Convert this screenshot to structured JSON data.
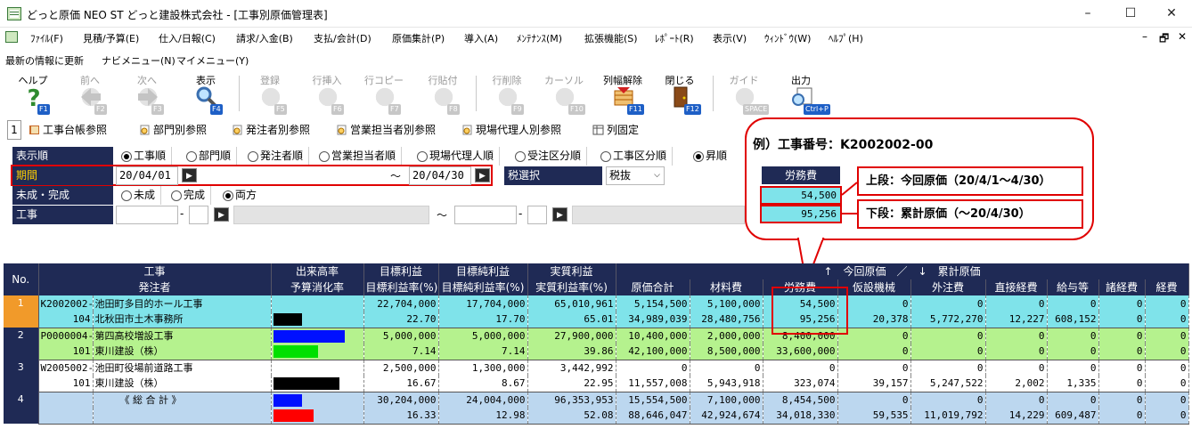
{
  "window": {
    "title": "どっと原価 NEO ST どっと建設株式会社 - [工事別原価管理表]",
    "controls": [
      "–",
      "☐",
      "✕"
    ],
    "mdi_controls": [
      "–",
      "🗗",
      "✕"
    ]
  },
  "menu": [
    "ﾌｧｲﾙ(F)",
    "見積/予算(E)",
    "仕入/日報(C)",
    "請求/入金(B)",
    "支払/会計(D)",
    "原価集計(P)",
    "導入(A)",
    "ﾒﾝﾃﾅﾝｽ(M)",
    "拡張機能(S)",
    "ﾚﾎﾟｰﾄ(R)",
    "表示(V)",
    "ｳｨﾝﾄﾞｳ(W)",
    "ﾍﾙﾌﾟ(H)"
  ],
  "infobar": [
    "最新の情報に更新",
    "ナビメニュー(N)",
    "マイメニュー(Y)"
  ],
  "toolbar": [
    {
      "label": "ヘルプ",
      "key": "F1",
      "icon": "help-icon",
      "enabled": true
    },
    {
      "label": "前へ",
      "key": "F2",
      "icon": "back-arrow-icon",
      "enabled": false
    },
    {
      "label": "次へ",
      "key": "F3",
      "icon": "forward-arrow-icon",
      "enabled": false
    },
    {
      "label": "表示",
      "key": "F4",
      "icon": "magnifier-icon",
      "enabled": true
    },
    {
      "label": "登録",
      "key": "F5",
      "icon": "register-icon",
      "enabled": false
    },
    {
      "label": "行挿入",
      "key": "F6",
      "icon": "row-insert-icon",
      "enabled": false
    },
    {
      "label": "行コピー",
      "key": "F7",
      "icon": "row-copy-icon",
      "enabled": false
    },
    {
      "label": "行貼付",
      "key": "F8",
      "icon": "row-paste-icon",
      "enabled": false
    },
    {
      "label": "行削除",
      "key": "F9",
      "icon": "row-delete-icon",
      "enabled": false
    },
    {
      "label": "カーソル",
      "key": "F10",
      "icon": "cursor-icon",
      "enabled": false
    },
    {
      "label": "列幅解除",
      "key": "F11",
      "icon": "column-width-icon",
      "enabled": true
    },
    {
      "label": "閉じる",
      "key": "F12",
      "icon": "door-icon",
      "enabled": true
    },
    {
      "label": "ガイド",
      "key": "SPACE",
      "icon": "lightbulb-icon",
      "enabled": false
    },
    {
      "label": "出力",
      "key": "Ctrl+P",
      "icon": "print-preview-icon",
      "enabled": true
    }
  ],
  "tabs": {
    "number": "1",
    "items": [
      "工事台帳参照",
      "部門別参照",
      "発注者別参照",
      "営業担当者別参照",
      "現場代理人別参照",
      "列固定"
    ]
  },
  "filters": {
    "order_label": "表示順",
    "order_options": [
      "工事順",
      "部門順",
      "発注者順",
      "営業担当者順",
      "現場代理人順",
      "受注区分順",
      "工事区分順",
      "昇順"
    ],
    "period_label": "期間",
    "period_from": "20/04/01",
    "period_sep": "～",
    "period_to": "20/04/30",
    "tax_label": "税選択",
    "tax_value": "税抜",
    "status_label": "未成・完成",
    "status_options": [
      "未成",
      "完成",
      "両方"
    ],
    "work_label": "工事",
    "work_dash1": "-",
    "work_sep": "～",
    "work_dash2": "-"
  },
  "callout": {
    "title": "例）工事番号：K2002002-00",
    "header": "労務費",
    "value_top": "54,500",
    "value_bottom": "95,256",
    "note_top": "上段：今回原価（20/4/1～4/30）",
    "note_bottom": "下段：累計原価（～20/4/30）"
  },
  "grid": {
    "header1": [
      "No.",
      "工事",
      "出来高率",
      "目標利益",
      "目標純利益",
      "実質利益",
      "↑　今回原価　／　↓　累計原価"
    ],
    "header2": [
      "発注者",
      "予算消化率",
      "目標利益率(%)",
      "目標純利益率(%)",
      "実質利益率(%)",
      "原価合計",
      "材料費",
      "労務費",
      "仮設機械",
      "外注費",
      "直接経費",
      "給与等",
      "諸経費",
      "経費"
    ],
    "rows": [
      {
        "no": "1",
        "top": [
          "K2002002-00",
          "池田町多目的ホール工事",
          "",
          "22,704,000",
          "17,704,000",
          "65,010,961",
          "5,154,500",
          "5,100,000",
          "54,500",
          "0",
          "0",
          "0",
          "0",
          "0",
          "0"
        ],
        "bottom": [
          "104",
          "北秋田市土木事務所",
          "",
          "22.70",
          "17.70",
          "65.01",
          "34,989,039",
          "28,480,756",
          "95,256",
          "20,378",
          "5,772,270",
          "12,227",
          "608,152",
          "0",
          "0"
        ],
        "bar_top": 0,
        "bar_bottom": 0.4,
        "bar_top_color": "#000000",
        "bar_bottom_color": "#000000"
      },
      {
        "no": "2",
        "top": [
          "P0000004-00",
          "第四高校増設工事",
          "",
          "5,000,000",
          "5,000,000",
          "27,900,000",
          "10,400,000",
          "2,000,000",
          "8,400,000",
          "0",
          "0",
          "0",
          "0",
          "0",
          "0"
        ],
        "bottom": [
          "101",
          "東川建設（株）",
          "",
          "7.14",
          "7.14",
          "39.86",
          "42,100,000",
          "8,500,000",
          "33,600,000",
          "0",
          "0",
          "0",
          "0",
          "0",
          "0"
        ],
        "bar_top": 1.0,
        "bar_bottom": 0.63,
        "bar_top_color": "#0010ff",
        "bar_bottom_color": "#00e000"
      },
      {
        "no": "3",
        "top": [
          "W2005002-00",
          "池田町役場前道路工事",
          "",
          "2,500,000",
          "1,300,000",
          "3,442,992",
          "0",
          "0",
          "0",
          "0",
          "0",
          "0",
          "0",
          "0",
          "0"
        ],
        "bottom": [
          "101",
          "東川建設（株）",
          "",
          "16.67",
          "8.67",
          "22.95",
          "11,557,008",
          "5,943,918",
          "323,074",
          "39,157",
          "5,247,522",
          "2,002",
          "1,335",
          "0",
          "0"
        ],
        "bar_top": 0,
        "bar_bottom": 0.93,
        "bar_top_color": "#000000",
        "bar_bottom_color": "#000000"
      },
      {
        "no": "4",
        "top": [
          "",
          "《 総 合 計 》",
          "",
          "30,204,000",
          "24,004,000",
          "96,353,953",
          "15,554,500",
          "7,100,000",
          "8,454,500",
          "0",
          "0",
          "0",
          "0",
          "0",
          "0"
        ],
        "bottom": [
          "",
          "",
          "",
          "16.33",
          "12.98",
          "52.08",
          "88,646,047",
          "42,924,674",
          "34,018,330",
          "59,535",
          "11,019,792",
          "14,229",
          "609,487",
          "0",
          "0"
        ],
        "bar_top": 0.4,
        "bar_bottom": 0.56,
        "bar_top_color": "#0010ff",
        "bar_bottom_color": "#ff0000"
      }
    ]
  }
}
